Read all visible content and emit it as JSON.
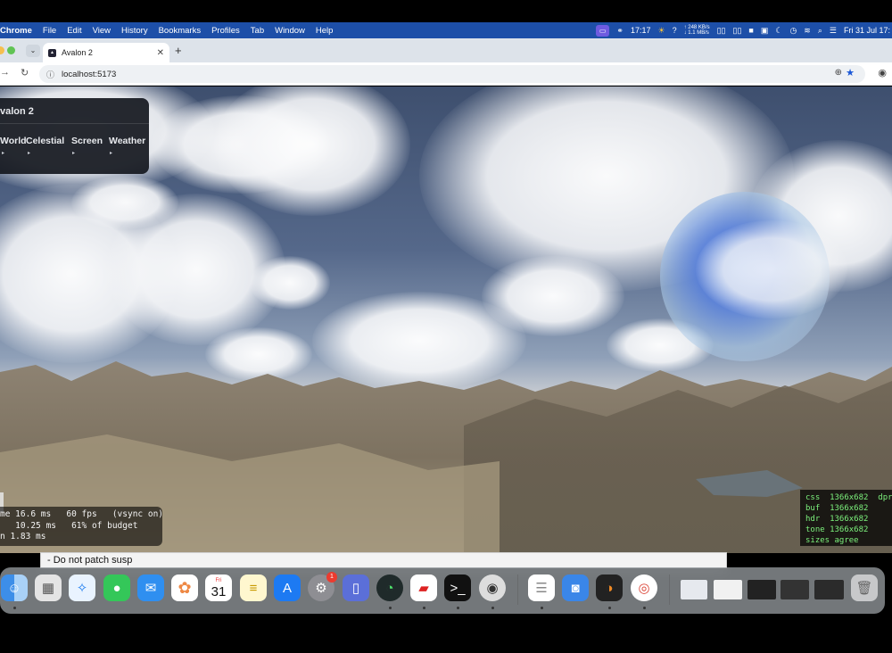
{
  "menubar": {
    "app_name": "Chrome",
    "items": [
      "File",
      "Edit",
      "View",
      "History",
      "Bookmarks",
      "Profiles",
      "Tab",
      "Window",
      "Help"
    ],
    "time": "17:17",
    "net_up": "↑ 248 KB/s",
    "net_down": "↓ 1.1 MB/s",
    "date": "Fri 31 Jul  17:"
  },
  "browser": {
    "tab_title": "Avalon 2",
    "url": "localhost:5173"
  },
  "panel": {
    "title": "valon 2",
    "tabs": [
      "World",
      "Celestial",
      "Screen",
      "Weather"
    ]
  },
  "perf": {
    "lines": [
      "me 16.6 ms   60 fps   (vsync on)",
      "   10.25 ms   61% of budget",
      "n 1.83 ms"
    ]
  },
  "sizes": {
    "lines": [
      "css  1366x682  dpr",
      "buf  1366x682",
      "hdr  1366x682",
      "tone 1366x682",
      "sizes agree"
    ]
  },
  "text_fragment": "- Do not patch susp",
  "dock": {
    "calendar_month": "Fri",
    "calendar_day": "31",
    "settings_badge": "1"
  }
}
